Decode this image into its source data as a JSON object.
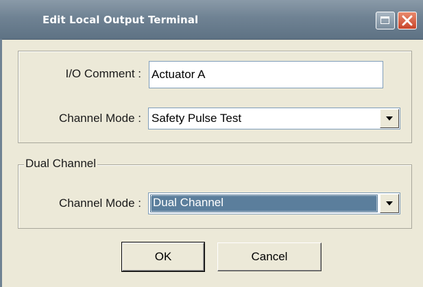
{
  "window": {
    "title": "Edit Local Output Terminal",
    "icons": {
      "maximize": "maximize-icon",
      "close": "close-icon"
    }
  },
  "form": {
    "io_comment_label": "I/O Comment :",
    "io_comment_value": "Actuator A",
    "channel_mode_label": "Channel Mode :",
    "channel_mode_value": "Safety Pulse Test"
  },
  "dual_channel": {
    "group_label": "Dual Channel",
    "channel_mode_label": "Channel Mode :",
    "channel_mode_value": "Dual Channel"
  },
  "buttons": {
    "ok_label": "OK",
    "cancel_label": "Cancel"
  },
  "colors": {
    "titlebar": "#6f8293",
    "dialog_bg": "#ece9d8",
    "selection": "#5b7e9c",
    "close_button": "#c8452a"
  }
}
